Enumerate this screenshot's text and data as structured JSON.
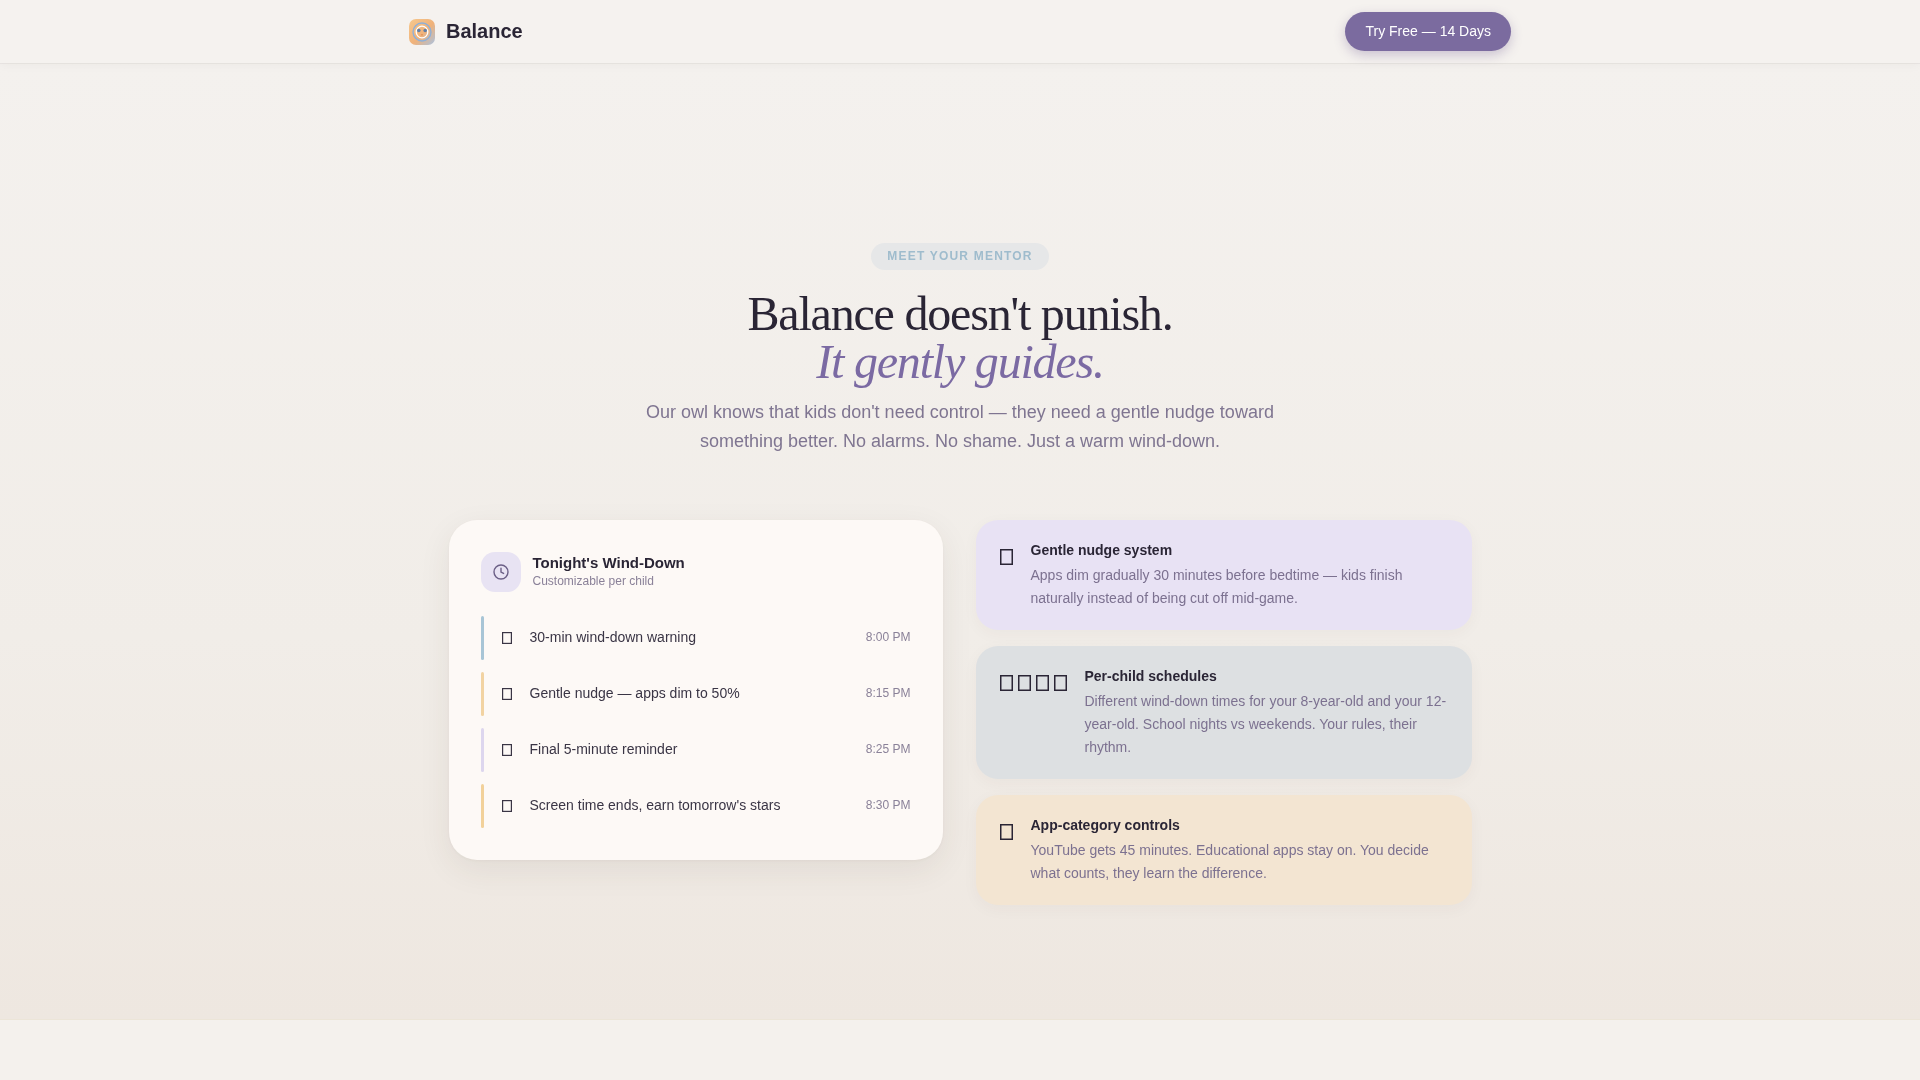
{
  "header": {
    "brand": "Balance",
    "cta": "Try Free — 14 Days"
  },
  "hero": {
    "badge": "MEET YOUR MENTOR",
    "title": "Balance doesn't punish.",
    "title_accent": "It gently guides.",
    "lead": "Our owl knows that kids don't need control — they need a gentle nudge toward something better. No alarms. No shame. Just a warm wind-down."
  },
  "schedule_card": {
    "title": "Tonight's Wind-Down",
    "subtitle": "Customizable per child",
    "steps": [
      {
        "label": "30-min wind-down warning",
        "time": "8:00 PM",
        "color": "#a8c5d6"
      },
      {
        "label": "Gentle nudge — apps dim to 50%",
        "time": "8:15 PM",
        "color": "#f2d3a2"
      },
      {
        "label": "Final 5-minute reminder",
        "time": "8:25 PM",
        "color": "#ddd6ee"
      },
      {
        "label": "Screen time ends, earn tomorrow's stars",
        "time": "8:30 PM",
        "color": "#f2d19a"
      }
    ]
  },
  "features": [
    {
      "kind": "single",
      "title": "Gentle nudge system",
      "description": "Apps dim gradually 30 minutes before bedtime — kids finish naturally instead of being cut off mid-game.",
      "color": "#e8e2f4"
    },
    {
      "kind": "quad",
      "title": "Per-child schedules",
      "description": "Different wind-down times for your 8-year-old and your 12-year-old. School nights vs weekends. Your rules, their rhythm.",
      "color": "#dde0e2"
    },
    {
      "kind": "single",
      "title": "App-category controls",
      "description": "YouTube gets 45 minutes. Educational apps stay on. You decide what counts, they learn the difference.",
      "color": "#f3e5d2"
    }
  ]
}
